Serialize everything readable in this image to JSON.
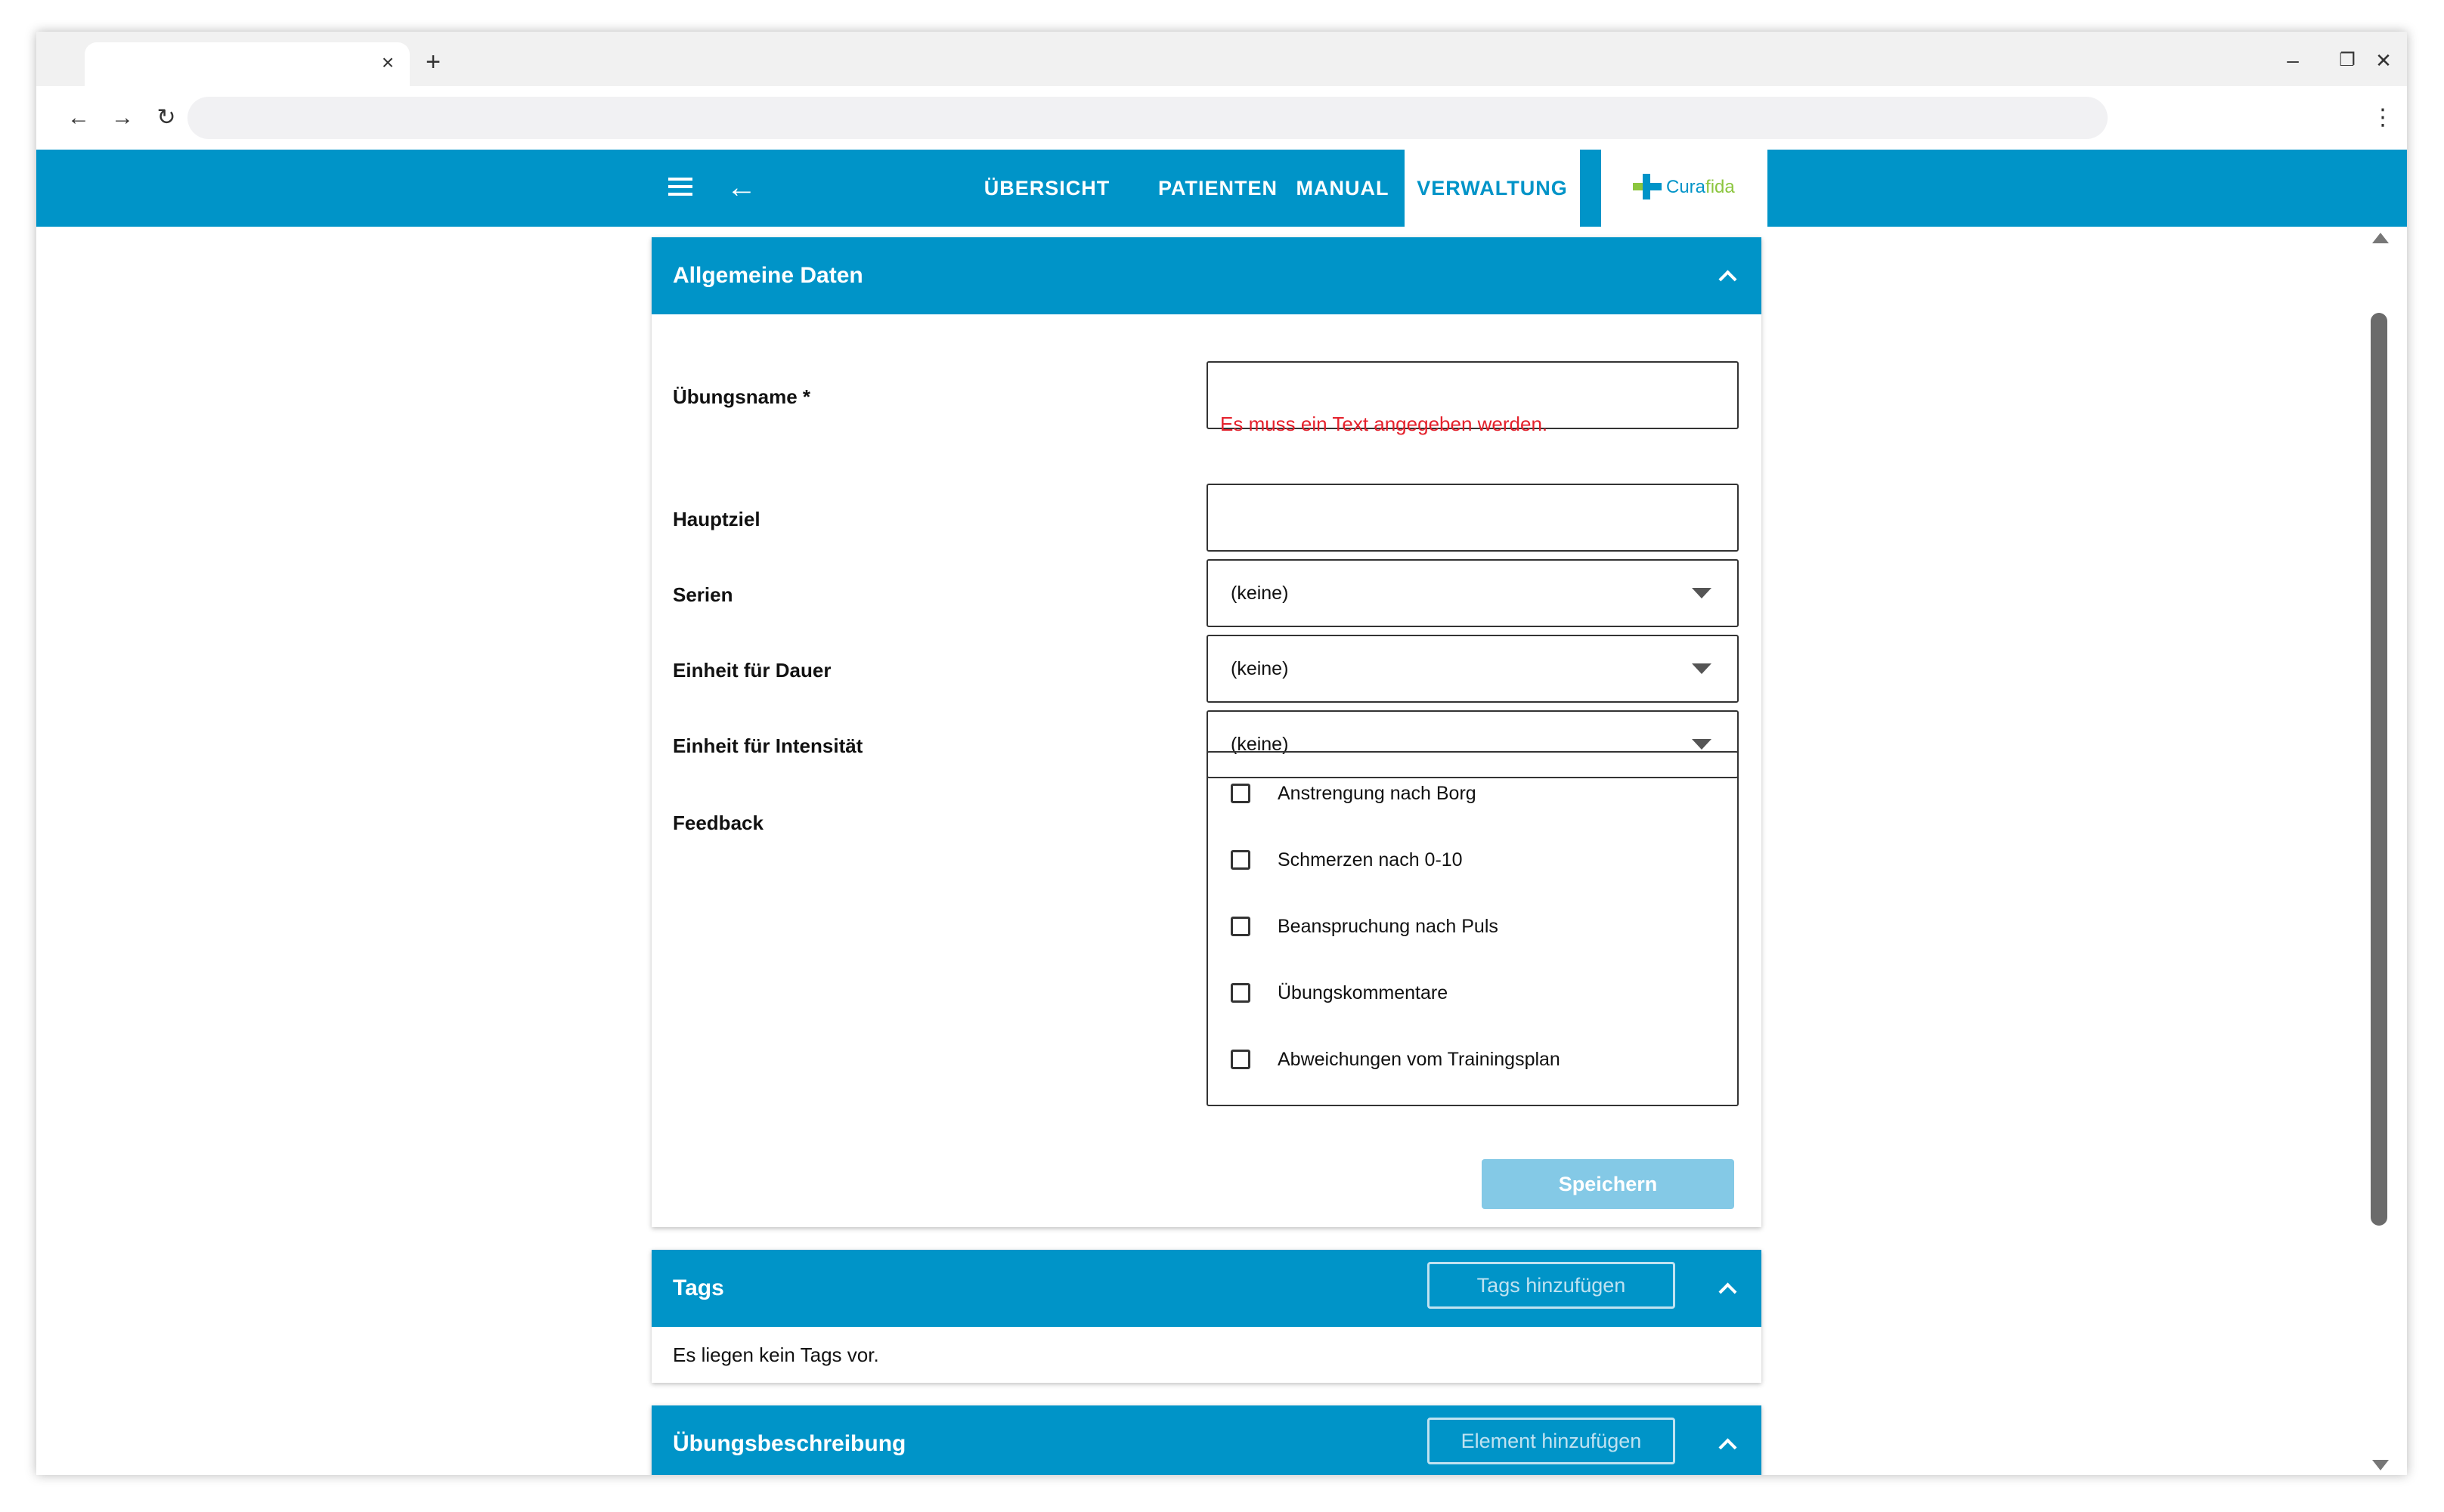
{
  "browser": {
    "tab_close": "×",
    "new_tab": "+",
    "win_min": "–",
    "win_restore": "❐",
    "win_close": "✕",
    "back": "←",
    "forward": "→",
    "reload": "↻",
    "menu": "⋮"
  },
  "header": {
    "nav": [
      "ÜBERSICHT",
      "PATIENTEN",
      "MANUAL",
      "VERWALTUNG"
    ],
    "active_tab": "VERWALTUNG",
    "logo_text_a": "Cura",
    "logo_text_b": "fida",
    "back_arrow": "←",
    "brand_color": "#0094c8"
  },
  "general": {
    "title": "Allgemeine Daten",
    "fields": {
      "name_label": "Übungsname *",
      "name_value": "",
      "name_error": "Es muss ein Text angegeben werden.",
      "goal_label": "Hauptziel",
      "goal_value": "",
      "series_label": "Serien",
      "series_value": "(keine)",
      "duration_label": "Einheit für Dauer",
      "duration_value": "(keine)",
      "intensity_label": "Einheit für Intensität",
      "intensity_value": "(keine)",
      "feedback_label": "Feedback"
    },
    "feedback_options": [
      "Anstrengung nach Borg",
      "Schmerzen nach 0-10",
      "Beanspruchung nach Puls",
      "Übungskommentare",
      "Abweichungen vom Trainingsplan"
    ],
    "save_label": "Speichern"
  },
  "tags": {
    "title": "Tags",
    "add_label": "Tags hinzufügen",
    "empty_text": "Es liegen kein Tags vor."
  },
  "description": {
    "title": "Übungsbeschreibung",
    "add_label": "Element hinzufügen"
  },
  "colors": {
    "error": "#e4212c",
    "save_disabled": "#84c9e6"
  }
}
